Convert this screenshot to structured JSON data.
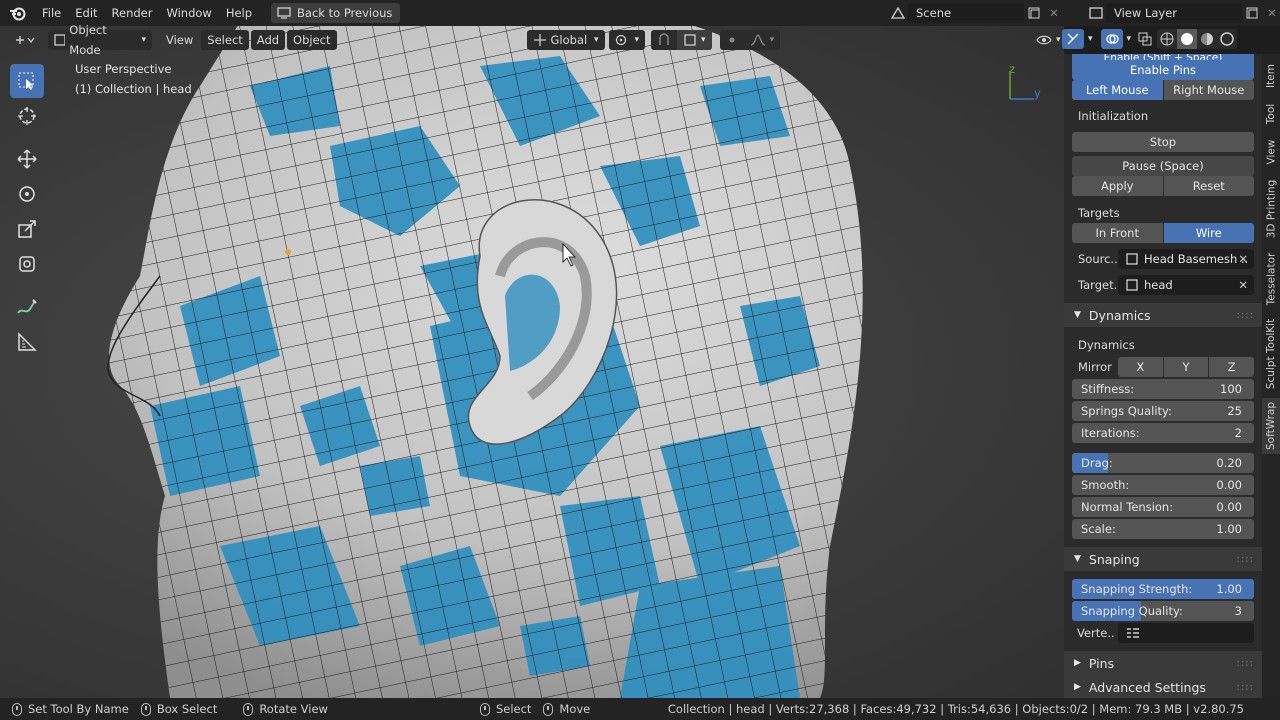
{
  "menubar": {
    "items": [
      "File",
      "Edit",
      "Render",
      "Window",
      "Help"
    ],
    "back_button": "Back to Previous",
    "scene": "Scene",
    "view_layer": "View Layer"
  },
  "viewport_header": {
    "mode": "Object Mode",
    "menus": [
      "View",
      "Select",
      "Add",
      "Object"
    ],
    "orientation": "Global"
  },
  "viewport": {
    "perspective": "User Perspective",
    "collection": "(1) Collection | head",
    "axis_z": "z",
    "axis_y": "y"
  },
  "panel": {
    "enable_pins_hint": "Enable (Shift + Space)",
    "enable_pins": "Enable Pins",
    "left_mouse": "Left Mouse",
    "right_mouse": "Right Mouse",
    "initialization_label": "Initialization",
    "stop": "Stop",
    "pause": "Pause (Space)",
    "apply": "Apply",
    "reset": "Reset",
    "targets_label": "Targets",
    "in_front": "In Front",
    "wire": "Wire",
    "source_label": "Sourc..",
    "source_value": "Head Basemesh ..",
    "target_label": "Target..",
    "target_value": "head",
    "dynamics_section": "Dynamics",
    "dynamics_label": "Dynamics",
    "mirror_label": "Mirror",
    "mirror_axes": [
      "X",
      "Y",
      "Z"
    ],
    "sliders": [
      {
        "label": "Stiffness:",
        "value": "100",
        "fraction": 0
      },
      {
        "label": "Springs Quality:",
        "value": "25",
        "fraction": 0
      },
      {
        "label": "Iterations:",
        "value": "2",
        "fraction": 0
      },
      {
        "label": "Drag:",
        "value": "0.20",
        "fraction": 0.2
      },
      {
        "label": "Smooth:",
        "value": "0.00",
        "fraction": 0
      },
      {
        "label": "Normal Tension:",
        "value": "0.00",
        "fraction": 0
      },
      {
        "label": "Scale:",
        "value": "1.00",
        "fraction": 0
      }
    ],
    "snaping_section": "Snaping",
    "snap_sliders": [
      {
        "label": "Snapping Strength:",
        "value": "1.00",
        "fraction": 1.0
      },
      {
        "label": "Snapping Quality:",
        "value": "3",
        "fraction": 0.38
      }
    ],
    "verte_label": "Verte..",
    "pins_section": "Pins",
    "advanced_section": "Advanced Settings"
  },
  "side_tabs": [
    "Item",
    "Tool",
    "View",
    "3D Printing",
    "Tesselator",
    "Sculpt ToolKit",
    "SoftWrap"
  ],
  "statusbar": {
    "set_tool": "Set Tool By Name",
    "box_select": "Box Select",
    "rotate_view": "Rotate View",
    "select": "Select",
    "move": "Move",
    "stats": "Collection | head | Verts:27,368 | Faces:49,732 | Tris:54,636 | Objects:0/2 | Mem: 79.3 MB | v2.80.75"
  },
  "colors": {
    "accent": "#4772b3",
    "mesh_blue": "#2f8fbf",
    "panel": "#2b2b2b"
  }
}
